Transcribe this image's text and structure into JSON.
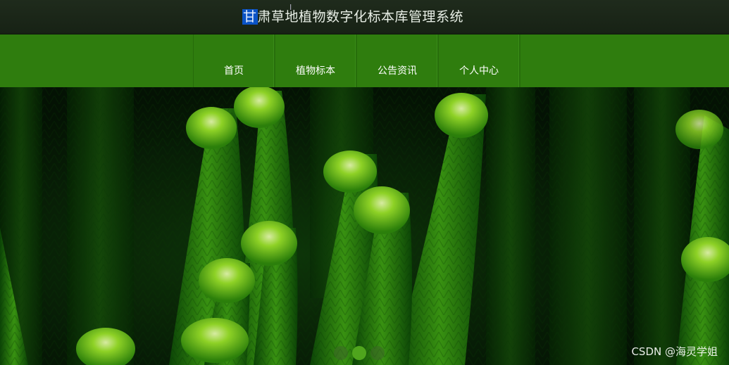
{
  "header": {
    "title_first_char": "甘",
    "title_rest": "肃草地植物数字化标本库管理系统"
  },
  "nav": {
    "items": [
      {
        "label": "首页"
      },
      {
        "label": "植物标本"
      },
      {
        "label": "公告资讯"
      },
      {
        "label": "个人中心"
      }
    ]
  },
  "carousel": {
    "slide_count": 3,
    "active_index": 1
  },
  "watermark": "CSDN @海灵学姐",
  "colors": {
    "topbar": "#1f2b1c",
    "nav": "#2f7d0e",
    "active_dot": "#4fa51d"
  }
}
